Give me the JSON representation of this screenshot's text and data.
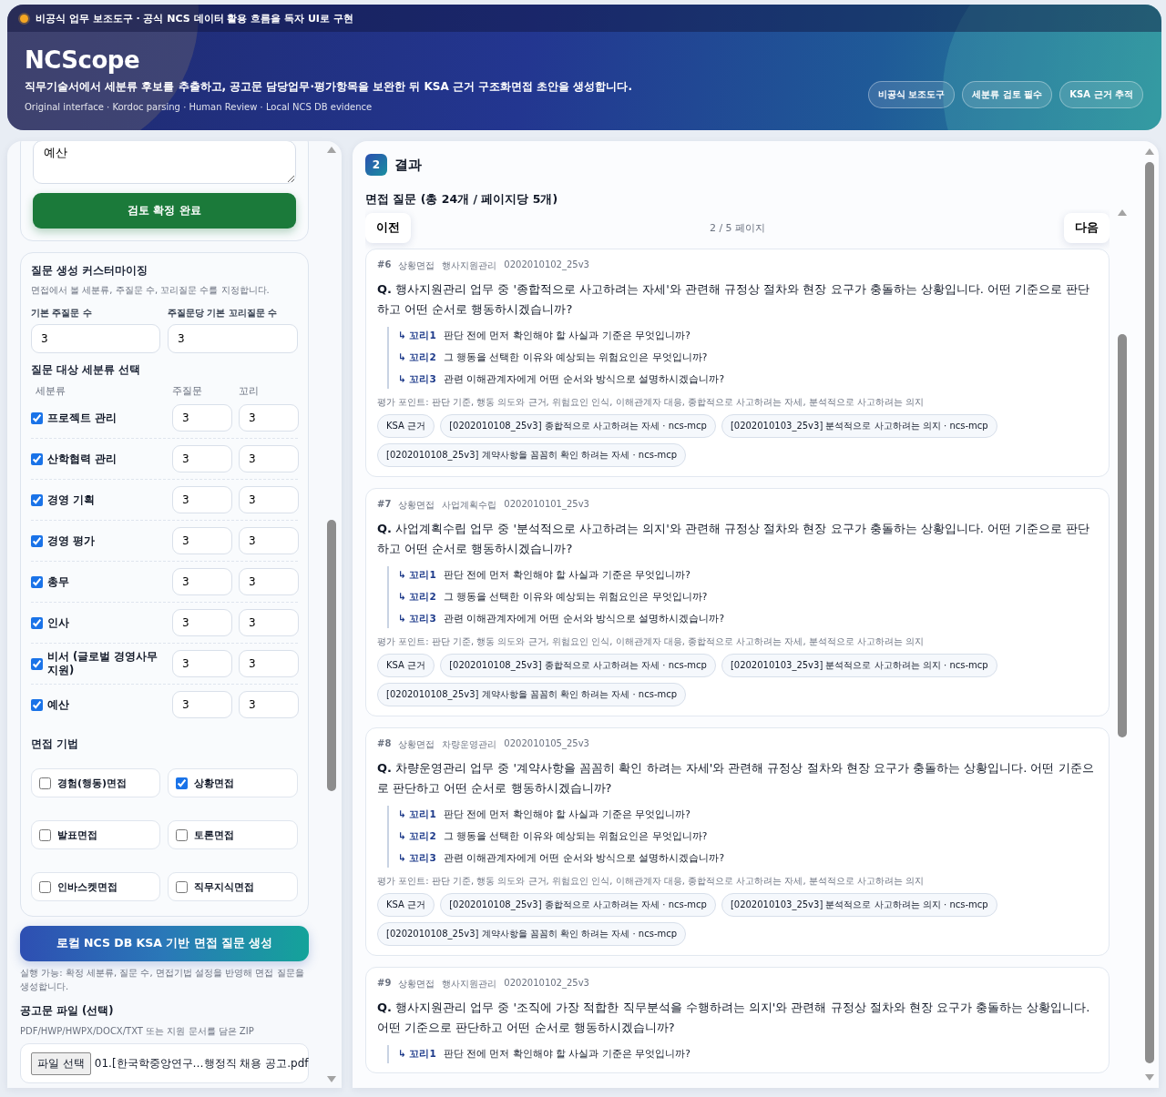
{
  "header": {
    "notice": "비공식 업무 보조도구 · 공식 NCS 데이터 활용 흐름을 독자 UI로 구현",
    "title": "NCScope",
    "subtitle": "직무기술서에서 세분류 후보를 추출하고, 공고문 담당업무·평가항목을 보완한 뒤 KSA 근거 구조화면접 초안을 생성합니다.",
    "meta": "Original interface · Kordoc parsing · Human Review · Local NCS DB evidence",
    "badges": [
      "비공식 보조도구",
      "세분류 검토 필수",
      "KSA 근거 추적"
    ]
  },
  "review": {
    "textarea_value": "예산",
    "confirm_button": "검토 확정 완료"
  },
  "customize": {
    "title": "질문 생성 커스터마이징",
    "description": "면접에서 볼 세분류, 주질문 수, 꼬리질문 수를 지정합니다.",
    "main_label": "기본 주질문 수",
    "main_value": "3",
    "tail_label": "주질문당 기본 꼬리질문 수",
    "tail_value": "3",
    "section_title": "질문 대상 세분류 선택",
    "columns": [
      "세분류",
      "주질문",
      "꼬리"
    ],
    "categories": [
      {
        "name": "프로젝트 관리",
        "checked": true,
        "main": "3",
        "tail": "3"
      },
      {
        "name": "산학협력 관리",
        "checked": true,
        "main": "3",
        "tail": "3"
      },
      {
        "name": "경영 기획",
        "checked": true,
        "main": "3",
        "tail": "3"
      },
      {
        "name": "경영 평가",
        "checked": true,
        "main": "3",
        "tail": "3"
      },
      {
        "name": "총무",
        "checked": true,
        "main": "3",
        "tail": "3"
      },
      {
        "name": "인사",
        "checked": true,
        "main": "3",
        "tail": "3"
      },
      {
        "name": "비서 (글로벌 경영사무 지원)",
        "checked": true,
        "main": "3",
        "tail": "3"
      },
      {
        "name": "예산",
        "checked": true,
        "main": "3",
        "tail": "3"
      }
    ],
    "techniques_title": "면접 기법",
    "techniques": [
      {
        "label": "경험(행동)면접",
        "checked": false
      },
      {
        "label": "상황면접",
        "checked": true
      },
      {
        "label": "발표면접",
        "checked": false
      },
      {
        "label": "토론면접",
        "checked": false
      },
      {
        "label": "인바스켓면접",
        "checked": false
      },
      {
        "label": "직무지식면접",
        "checked": false
      }
    ]
  },
  "generate": {
    "button": "로컬 NCS DB KSA 기반 면접 질문 생성",
    "help": "실행 가능: 확정 세분류, 질문 수, 면접기법 설정을 반영해 면접 질문을 생성합니다."
  },
  "file_upload": {
    "label": "공고문 파일 (선택)",
    "hint": "PDF/HWP/HWPX/DOCX/TXT 또는 지원 문서를 담은 ZIP",
    "button": "파일 선택",
    "filename": "01.[한국학중앙연구…행정직 채용 공고.pdf"
  },
  "results": {
    "step": "2",
    "title": "결과",
    "heading": "면접 질문 (총 24개 / 페이지당 5개)",
    "prev": "이전",
    "page": "2 / 5 페이지",
    "next": "다음",
    "questions": [
      {
        "number": "#6",
        "technique": "상황면접",
        "area": "행사지원관리",
        "code": "0202010102_25v3",
        "question": "**Q.** 행사지원관리 업무 중 '종합적으로 사고하려는 자세'와 관련해 규정상 절차와 현장 요구가 충돌하는 상황입니다. 어떤 기준으로 판단하고 어떤 순서로 행동하시겠습니까?",
        "followups": [
          {
            "label": "↳ 꼬리1",
            "text": "판단 전에 먼저 확인해야 할 사실과 기준은 무엇입니까?"
          },
          {
            "label": "↳ 꼬리2",
            "text": "그 행동을 선택한 이유와 예상되는 위험요인은 무엇입니까?"
          },
          {
            "label": "↳ 꼬리3",
            "text": "관련 이해관계자에게 어떤 순서와 방식으로 설명하시겠습니까?"
          }
        ],
        "eval": "평가 포인트: 판단 기준, 행동 의도와 근거, 위험요인 인식, 이해관계자 대응, 종합적으로 사고하려는 자세, 분석적으로 사고하려는 의지",
        "tags": [
          "KSA 근거",
          "[0202010108_25v3] 종합적으로 사고하려는 자세 · ncs-mcp",
          "[0202010103_25v3] 분석적으로 사고하려는 의지 · ncs-mcp",
          "[0202010108_25v3] 계약사항을 꼼꼼히 확인 하려는 자세 · ncs-mcp"
        ]
      },
      {
        "number": "#7",
        "technique": "상황면접",
        "area": "사업계획수립",
        "code": "0202010101_25v3",
        "question": "**Q.** 사업계획수립 업무 중 '분석적으로 사고하려는 의지'와 관련해 규정상 절차와 현장 요구가 충돌하는 상황입니다. 어떤 기준으로 판단하고 어떤 순서로 행동하시겠습니까?",
        "followups": [
          {
            "label": "↳ 꼬리1",
            "text": "판단 전에 먼저 확인해야 할 사실과 기준은 무엇입니까?"
          },
          {
            "label": "↳ 꼬리2",
            "text": "그 행동을 선택한 이유와 예상되는 위험요인은 무엇입니까?"
          },
          {
            "label": "↳ 꼬리3",
            "text": "관련 이해관계자에게 어떤 순서와 방식으로 설명하시겠습니까?"
          }
        ],
        "eval": "평가 포인트: 판단 기준, 행동 의도와 근거, 위험요인 인식, 이해관계자 대응, 종합적으로 사고하려는 자세, 분석적으로 사고하려는 의지",
        "tags": [
          "KSA 근거",
          "[0202010108_25v3] 종합적으로 사고하려는 자세 · ncs-mcp",
          "[0202010103_25v3] 분석적으로 사고하려는 의지 · ncs-mcp",
          "[0202010108_25v3] 계약사항을 꼼꼼히 확인 하려는 자세 · ncs-mcp"
        ]
      },
      {
        "number": "#8",
        "technique": "상황면접",
        "area": "차량운영관리",
        "code": "0202010105_25v3",
        "question": "**Q.** 차량운영관리 업무 중 '계약사항을 꼼꼼히 확인 하려는 자세'와 관련해 규정상 절차와 현장 요구가 충돌하는 상황입니다. 어떤 기준으로 판단하고 어떤 순서로 행동하시겠습니까?",
        "followups": [
          {
            "label": "↳ 꼬리1",
            "text": "판단 전에 먼저 확인해야 할 사실과 기준은 무엇입니까?"
          },
          {
            "label": "↳ 꼬리2",
            "text": "그 행동을 선택한 이유와 예상되는 위험요인은 무엇입니까?"
          },
          {
            "label": "↳ 꼬리3",
            "text": "관련 이해관계자에게 어떤 순서와 방식으로 설명하시겠습니까?"
          }
        ],
        "eval": "평가 포인트: 판단 기준, 행동 의도와 근거, 위험요인 인식, 이해관계자 대응, 종합적으로 사고하려는 자세, 분석적으로 사고하려는 의지",
        "tags": [
          "KSA 근거",
          "[0202010108_25v3] 종합적으로 사고하려는 자세 · ncs-mcp",
          "[0202010103_25v3] 분석적으로 사고하려는 의지 · ncs-mcp",
          "[0202010108_25v3] 계약사항을 꼼꼼히 확인 하려는 자세 · ncs-mcp"
        ]
      },
      {
        "number": "#9",
        "technique": "상황면접",
        "area": "행사지원관리",
        "code": "0202010102_25v3",
        "question": "**Q.** 행사지원관리 업무 중 '조직에 가장 적합한 직무분석을 수행하려는 의지'와 관련해 규정상 절차와 현장 요구가 충돌하는 상황입니다. 어떤 기준으로 판단하고 어떤 순서로 행동하시겠습니까?",
        "followups": [
          {
            "label": "↳ 꼬리1",
            "text": "판단 전에 먼저 확인해야 할 사실과 기준은 무엇입니까?"
          }
        ]
      }
    ]
  }
}
